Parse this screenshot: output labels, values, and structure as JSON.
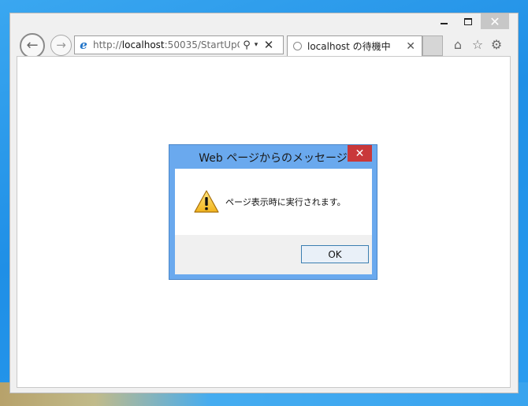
{
  "window": {
    "caption_close": "✕"
  },
  "toolbar": {
    "back_glyph": "←",
    "forward_glyph": "→",
    "address_prefix": "http://",
    "address_host": "localhost",
    "address_rest": ":50035/StartUpC",
    "ie_glyph": "e",
    "search_glyph": "⚲",
    "dropdown_glyph": "▾",
    "stop_glyph": "✕",
    "home_glyph": "⌂",
    "favorites_glyph": "☆",
    "settings_glyph": "⚙"
  },
  "tab": {
    "label": "localhost の待機中",
    "close_glyph": "✕"
  },
  "dialog": {
    "title": "Web ページからのメッセージ",
    "close_glyph": "✕",
    "message": "ページ表示時に実行されます。",
    "ok_label": "OK"
  },
  "icons": {
    "back": "back-arrow-icon",
    "forward": "forward-arrow-icon",
    "ie": "internet-explorer-icon",
    "search": "search-icon",
    "stop": "close-icon",
    "loading": "loading-spinner-icon",
    "home": "home-icon",
    "favorites": "star-icon",
    "settings": "gear-icon",
    "warning": "warning-icon"
  },
  "colors": {
    "desktop": "#2a9cf0",
    "dialog_frame": "#6aa9ee",
    "dialog_close": "#c9383a",
    "ok_border": "#3c7fb1",
    "ie_blue": "#1f73c8"
  }
}
